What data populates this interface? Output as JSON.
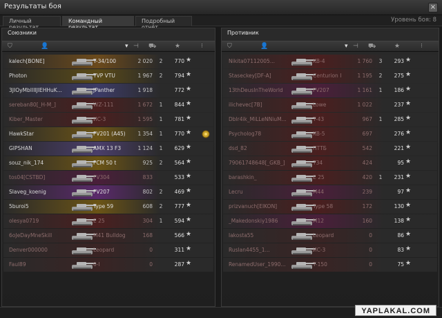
{
  "window": {
    "title": "Результаты боя",
    "close_label": "×"
  },
  "tabs": [
    {
      "label": "Личный результат",
      "active": false
    },
    {
      "label": "Командный результат",
      "active": true
    },
    {
      "label": "Подробный отчёт",
      "active": false
    }
  ],
  "battle_level": "Уровень боя: 8",
  "headers": {
    "tank_icon": "tank-column-icon",
    "player_icon": "player-icon",
    "sort_icon": "sort-icon",
    "damage_icon": "damage-icon",
    "kills_icon": "kills-icon",
    "xp_icon": "star-icon",
    "medals_icon": "medals-icon"
  },
  "allies": {
    "title": "Союзники",
    "rows": [
      {
        "player": "kalech[BONE]",
        "tank": "T-34/100",
        "damage": "2 020",
        "kills": "2",
        "xp": "770",
        "alive": true,
        "tint": "#6b4a1c"
      },
      {
        "player": "Photon",
        "tank": "TVP VTU",
        "damage": "1 967",
        "kills": "2",
        "xp": "794",
        "alive": true,
        "tint": "#5a4a17"
      },
      {
        "player": "3JIOyMbIIIIJIEHHuK...",
        "tank": "JPanther",
        "damage": "1 918",
        "kills": "",
        "xp": "772",
        "alive": true,
        "tint": "#3c3b66"
      },
      {
        "player": "sereban80[_H-M_]",
        "tank": "WZ-111",
        "damage": "1 672",
        "kills": "1",
        "xp": "844",
        "alive": false,
        "tint": "#4a1f1f"
      },
      {
        "player": "Kiber_Master",
        "tank": "ИС-3",
        "damage": "1 595",
        "kills": "1",
        "xp": "781",
        "alive": false,
        "tint": "#4a1f1f"
      },
      {
        "player": "HawkStar",
        "tank": "FV201 (A45)",
        "damage": "1 354",
        "kills": "1",
        "xp": "770",
        "alive": true,
        "tint": "#6b5416",
        "medal": true
      },
      {
        "player": "GIPSHAN",
        "tank": "AMX 13 F3",
        "damage": "1 124",
        "kills": "1",
        "xp": "629",
        "alive": true,
        "tint": "#4a3e6a"
      },
      {
        "player": "souz_nik_174",
        "tank": "FCM 50 t",
        "damage": "925",
        "kills": "2",
        "xp": "564",
        "alive": true,
        "tint": "#6b5416"
      },
      {
        "player": "tos04[CSTBD]",
        "tank": "FV304",
        "damage": "833",
        "kills": "",
        "xp": "533",
        "alive": false,
        "tint": "#4a1f3a"
      },
      {
        "player": "Slaveg_koenig",
        "tank": "FV207",
        "damage": "802",
        "kills": "2",
        "xp": "469",
        "alive": true,
        "tint": "#5a2a6a"
      },
      {
        "player": "5buroi5",
        "tank": "Type 59",
        "damage": "608",
        "kills": "2",
        "xp": "777",
        "alive": true,
        "tint": "#6b5416"
      },
      {
        "player": "olesya0719",
        "tank": "E 25",
        "damage": "304",
        "kills": "1",
        "xp": "594",
        "alive": false,
        "tint": "#4a1f1f"
      },
      {
        "player": "6oJeDayMneSkill",
        "tank": "M41 Bulldog",
        "damage": "168",
        "kills": "",
        "xp": "566",
        "alive": false,
        "tint": "#3a2424"
      },
      {
        "player": "Denver000000",
        "tank": "Leopard",
        "damage": "0",
        "kills": "",
        "xp": "311",
        "alive": false,
        "tint": "#3a2424"
      },
      {
        "player": "Faul89",
        "tank": "0-I",
        "damage": "0",
        "kills": "",
        "xp": "287",
        "alive": false,
        "tint": "#3a2424"
      }
    ]
  },
  "enemies": {
    "title": "Противник",
    "rows": [
      {
        "player": "Nikita07112005...",
        "tank": "KB-4",
        "damage": "1 760",
        "kills": "3",
        "xp": "293",
        "alive": false,
        "tint": "#4a1f1f"
      },
      {
        "player": "Staseckey[DF-A]",
        "tank": "Centurion I",
        "damage": "1 195",
        "kills": "2",
        "xp": "275",
        "alive": false,
        "tint": "#4a1f1f"
      },
      {
        "player": "13thDeusInTheWorld",
        "tank": "FV207",
        "damage": "1 161",
        "kills": "1",
        "xp": "186",
        "alive": false,
        "tint": "#4a1f3a"
      },
      {
        "player": "ilichevec[7B]",
        "tank": "Lowe",
        "damage": "1 022",
        "kills": "",
        "xp": "237",
        "alive": false,
        "tint": "#4a1f1f"
      },
      {
        "player": "Dblr4ik_MiLLeNNiuM...",
        "tank": "T-43",
        "damage": "967",
        "kills": "1",
        "xp": "285",
        "alive": false,
        "tint": "#4a1f1f"
      },
      {
        "player": "Psycholog78",
        "tank": "KB-5",
        "damage": "697",
        "kills": "",
        "xp": "276",
        "alive": false,
        "tint": "#4a1f1f"
      },
      {
        "player": "dsd_82",
        "tank": "ПТТБ",
        "damage": "542",
        "kills": "",
        "xp": "221",
        "alive": false,
        "tint": "#4a1f1f"
      },
      {
        "player": "79061748648[_GKB_]",
        "tank": "T34",
        "damage": "424",
        "kills": "",
        "xp": "95",
        "alive": false,
        "tint": "#4a1f1f"
      },
      {
        "player": "barashkin_",
        "tank": "E 25",
        "damage": "420",
        "kills": "1",
        "xp": "231",
        "alive": false,
        "tint": "#4a1f1f"
      },
      {
        "player": "Lecru",
        "tank": "M44",
        "damage": "239",
        "kills": "",
        "xp": "97",
        "alive": false,
        "tint": "#4a1f3a"
      },
      {
        "player": "prizvanuch[EIKON]",
        "tank": "Type 58",
        "damage": "172",
        "kills": "",
        "xp": "130",
        "alive": false,
        "tint": "#4a1f1f"
      },
      {
        "player": "_Makedonskiy1986",
        "tank": "M12",
        "damage": "160",
        "kills": "",
        "xp": "138",
        "alive": false,
        "tint": "#4a1f3a"
      },
      {
        "player": "lakosta55",
        "tank": "Leopard",
        "damage": "0",
        "kills": "",
        "xp": "86",
        "alive": false,
        "tint": "#3a2424"
      },
      {
        "player": "Ruslan4455_1...",
        "tank": "ИС-3",
        "damage": "0",
        "kills": "",
        "xp": "83",
        "alive": false,
        "tint": "#3a2424"
      },
      {
        "player": "RenamedUser_1990...",
        "tank": "T-150",
        "damage": "0",
        "kills": "",
        "xp": "75",
        "alive": false,
        "tint": "#3a2424"
      }
    ]
  },
  "watermark": "YAPLAKAL.COM"
}
